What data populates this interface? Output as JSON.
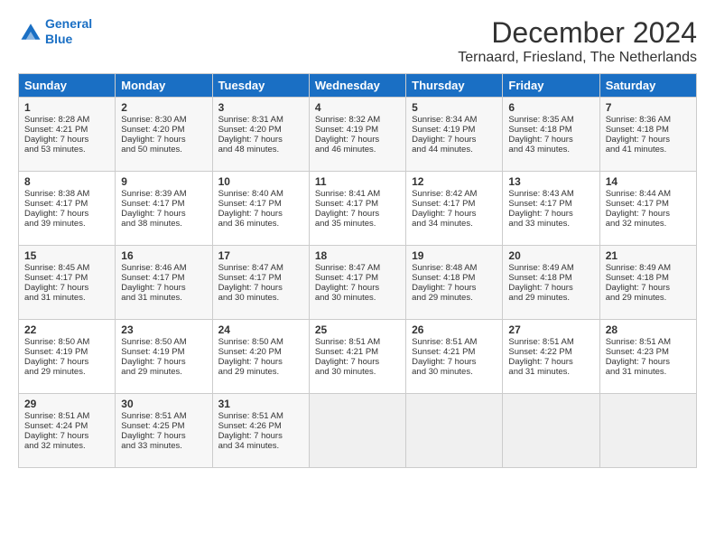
{
  "header": {
    "logo_line1": "General",
    "logo_line2": "Blue",
    "title": "December 2024",
    "subtitle": "Ternaard, Friesland, The Netherlands"
  },
  "calendar": {
    "days_of_week": [
      "Sunday",
      "Monday",
      "Tuesday",
      "Wednesday",
      "Thursday",
      "Friday",
      "Saturday"
    ],
    "weeks": [
      [
        {
          "day": "1",
          "lines": [
            "Sunrise: 8:28 AM",
            "Sunset: 4:21 PM",
            "Daylight: 7 hours",
            "and 53 minutes."
          ]
        },
        {
          "day": "2",
          "lines": [
            "Sunrise: 8:30 AM",
            "Sunset: 4:20 PM",
            "Daylight: 7 hours",
            "and 50 minutes."
          ]
        },
        {
          "day": "3",
          "lines": [
            "Sunrise: 8:31 AM",
            "Sunset: 4:20 PM",
            "Daylight: 7 hours",
            "and 48 minutes."
          ]
        },
        {
          "day": "4",
          "lines": [
            "Sunrise: 8:32 AM",
            "Sunset: 4:19 PM",
            "Daylight: 7 hours",
            "and 46 minutes."
          ]
        },
        {
          "day": "5",
          "lines": [
            "Sunrise: 8:34 AM",
            "Sunset: 4:19 PM",
            "Daylight: 7 hours",
            "and 44 minutes."
          ]
        },
        {
          "day": "6",
          "lines": [
            "Sunrise: 8:35 AM",
            "Sunset: 4:18 PM",
            "Daylight: 7 hours",
            "and 43 minutes."
          ]
        },
        {
          "day": "7",
          "lines": [
            "Sunrise: 8:36 AM",
            "Sunset: 4:18 PM",
            "Daylight: 7 hours",
            "and 41 minutes."
          ]
        }
      ],
      [
        {
          "day": "8",
          "lines": [
            "Sunrise: 8:38 AM",
            "Sunset: 4:17 PM",
            "Daylight: 7 hours",
            "and 39 minutes."
          ]
        },
        {
          "day": "9",
          "lines": [
            "Sunrise: 8:39 AM",
            "Sunset: 4:17 PM",
            "Daylight: 7 hours",
            "and 38 minutes."
          ]
        },
        {
          "day": "10",
          "lines": [
            "Sunrise: 8:40 AM",
            "Sunset: 4:17 PM",
            "Daylight: 7 hours",
            "and 36 minutes."
          ]
        },
        {
          "day": "11",
          "lines": [
            "Sunrise: 8:41 AM",
            "Sunset: 4:17 PM",
            "Daylight: 7 hours",
            "and 35 minutes."
          ]
        },
        {
          "day": "12",
          "lines": [
            "Sunrise: 8:42 AM",
            "Sunset: 4:17 PM",
            "Daylight: 7 hours",
            "and 34 minutes."
          ]
        },
        {
          "day": "13",
          "lines": [
            "Sunrise: 8:43 AM",
            "Sunset: 4:17 PM",
            "Daylight: 7 hours",
            "and 33 minutes."
          ]
        },
        {
          "day": "14",
          "lines": [
            "Sunrise: 8:44 AM",
            "Sunset: 4:17 PM",
            "Daylight: 7 hours",
            "and 32 minutes."
          ]
        }
      ],
      [
        {
          "day": "15",
          "lines": [
            "Sunrise: 8:45 AM",
            "Sunset: 4:17 PM",
            "Daylight: 7 hours",
            "and 31 minutes."
          ]
        },
        {
          "day": "16",
          "lines": [
            "Sunrise: 8:46 AM",
            "Sunset: 4:17 PM",
            "Daylight: 7 hours",
            "and 31 minutes."
          ]
        },
        {
          "day": "17",
          "lines": [
            "Sunrise: 8:47 AM",
            "Sunset: 4:17 PM",
            "Daylight: 7 hours",
            "and 30 minutes."
          ]
        },
        {
          "day": "18",
          "lines": [
            "Sunrise: 8:47 AM",
            "Sunset: 4:17 PM",
            "Daylight: 7 hours",
            "and 30 minutes."
          ]
        },
        {
          "day": "19",
          "lines": [
            "Sunrise: 8:48 AM",
            "Sunset: 4:18 PM",
            "Daylight: 7 hours",
            "and 29 minutes."
          ]
        },
        {
          "day": "20",
          "lines": [
            "Sunrise: 8:49 AM",
            "Sunset: 4:18 PM",
            "Daylight: 7 hours",
            "and 29 minutes."
          ]
        },
        {
          "day": "21",
          "lines": [
            "Sunrise: 8:49 AM",
            "Sunset: 4:18 PM",
            "Daylight: 7 hours",
            "and 29 minutes."
          ]
        }
      ],
      [
        {
          "day": "22",
          "lines": [
            "Sunrise: 8:50 AM",
            "Sunset: 4:19 PM",
            "Daylight: 7 hours",
            "and 29 minutes."
          ]
        },
        {
          "day": "23",
          "lines": [
            "Sunrise: 8:50 AM",
            "Sunset: 4:19 PM",
            "Daylight: 7 hours",
            "and 29 minutes."
          ]
        },
        {
          "day": "24",
          "lines": [
            "Sunrise: 8:50 AM",
            "Sunset: 4:20 PM",
            "Daylight: 7 hours",
            "and 29 minutes."
          ]
        },
        {
          "day": "25",
          "lines": [
            "Sunrise: 8:51 AM",
            "Sunset: 4:21 PM",
            "Daylight: 7 hours",
            "and 30 minutes."
          ]
        },
        {
          "day": "26",
          "lines": [
            "Sunrise: 8:51 AM",
            "Sunset: 4:21 PM",
            "Daylight: 7 hours",
            "and 30 minutes."
          ]
        },
        {
          "day": "27",
          "lines": [
            "Sunrise: 8:51 AM",
            "Sunset: 4:22 PM",
            "Daylight: 7 hours",
            "and 31 minutes."
          ]
        },
        {
          "day": "28",
          "lines": [
            "Sunrise: 8:51 AM",
            "Sunset: 4:23 PM",
            "Daylight: 7 hours",
            "and 31 minutes."
          ]
        }
      ],
      [
        {
          "day": "29",
          "lines": [
            "Sunrise: 8:51 AM",
            "Sunset: 4:24 PM",
            "Daylight: 7 hours",
            "and 32 minutes."
          ]
        },
        {
          "day": "30",
          "lines": [
            "Sunrise: 8:51 AM",
            "Sunset: 4:25 PM",
            "Daylight: 7 hours",
            "and 33 minutes."
          ]
        },
        {
          "day": "31",
          "lines": [
            "Sunrise: 8:51 AM",
            "Sunset: 4:26 PM",
            "Daylight: 7 hours",
            "and 34 minutes."
          ]
        },
        {
          "day": "",
          "lines": []
        },
        {
          "day": "",
          "lines": []
        },
        {
          "day": "",
          "lines": []
        },
        {
          "day": "",
          "lines": []
        }
      ]
    ]
  }
}
